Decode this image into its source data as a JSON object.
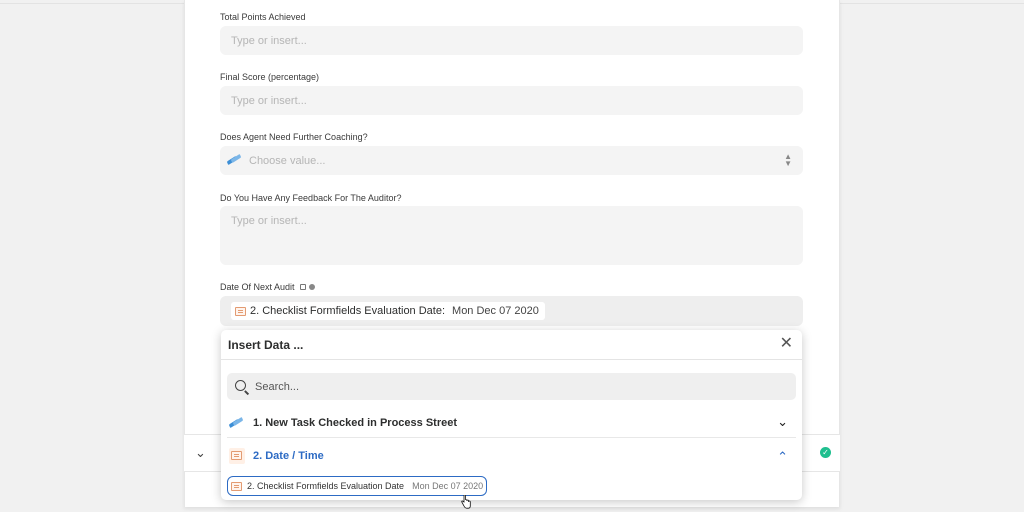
{
  "colors": {
    "accent": "#2d6bc4",
    "success": "#1fbf8f",
    "field_bg": "#f4f4f4"
  },
  "fields": [
    {
      "label": "Total Points Achieved",
      "placeholder": "Type or insert..."
    },
    {
      "label": "Final Score (percentage)",
      "placeholder": "Type or insert..."
    },
    {
      "label": "Does Agent Need Further Coaching?",
      "placeholder": "Choose value..."
    },
    {
      "label": "Do You Have Any Feedback For The Auditor?",
      "placeholder": "Type or insert..."
    }
  ],
  "date_field": {
    "label": "Date Of Next Audit",
    "chip_label": "2. Checklist Formfields Evaluation Date:",
    "chip_value": "Mon Dec 07 2020"
  },
  "insert_data": {
    "title": "Insert Data ...",
    "search_placeholder": "Search...",
    "groups": [
      {
        "label": "1. New Task Checked in Process Street",
        "icon": "process-street-icon",
        "expanded": false
      },
      {
        "label": "2. Date / Time",
        "icon": "date-time-icon",
        "expanded": true
      }
    ],
    "items": [
      {
        "label": "2. Checklist Formfields Evaluation Date",
        "value": "Mon Dec 07 2020"
      }
    ]
  }
}
